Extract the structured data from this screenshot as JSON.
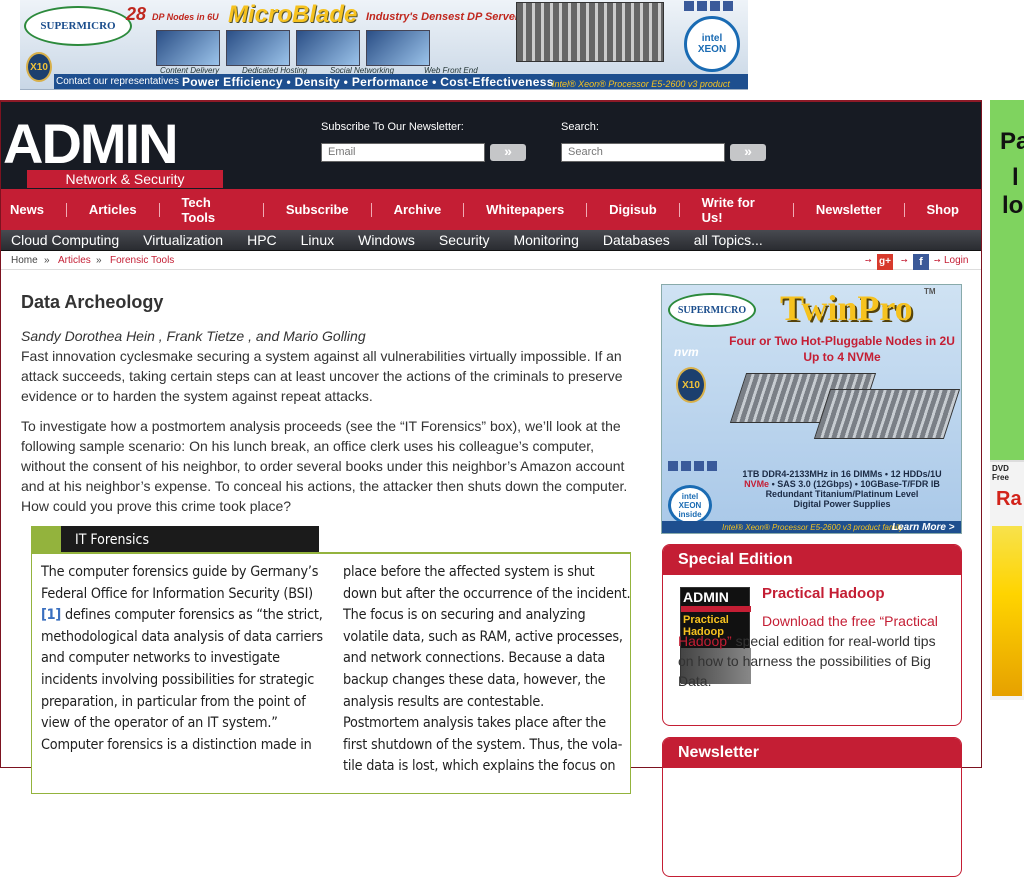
{
  "top_ad": {
    "brand": "SUPERMICRO",
    "count": "28",
    "nodes": "DP Nodes in 6U",
    "title": "MicroBlade",
    "tagline": "Industry's Densest DP Server",
    "captions": [
      "Content Delivery",
      "Dedicated Hosting",
      "Social Networking",
      "Web Front End"
    ],
    "contact": "Contact our representatives",
    "slogan": "Power Efficiency • Density • Performance • Cost-Effectiveness",
    "xeon": "Intel® Xeon® Processor E5-2600 v3 product family",
    "x10": "X10",
    "intel": "intel",
    "intel_sub": "XEON"
  },
  "side_ad": {
    "line1": "Pa",
    "line2": "l",
    "line3": "lo",
    "mag_top": "DVD Free",
    "mag_title": "Ra"
  },
  "header": {
    "logo": "ADMIN",
    "logo_sub": "Network & Security",
    "newsletter_label": "Subscribe To Our Newsletter:",
    "newsletter_placeholder": "Email",
    "search_label": "Search:",
    "search_placeholder": "Search",
    "go_glyph": "»"
  },
  "nav": {
    "items": [
      "News",
      "Articles",
      "Tech Tools",
      "Subscribe",
      "Archive",
      "Whitepapers",
      "Digisub",
      "Write for Us!",
      "Newsletter",
      "Shop"
    ]
  },
  "subnav": {
    "items": [
      "Cloud Computing",
      "Virtualization",
      "HPC",
      "Linux",
      "Windows",
      "Security",
      "Monitoring",
      "Databases",
      "all Topics..."
    ]
  },
  "breadcrumb": {
    "home": "Home",
    "sep": "»",
    "articles": "Articles",
    "current": "Forensic Tools",
    "login": "Login",
    "gplus": "g+",
    "fb": "f"
  },
  "article": {
    "title": "Data Archeology",
    "authors": "Sandy Dorothea Hein , Frank Tietze , and Mario Golling",
    "lead": "Fast innovation cyclesmake securing a system against all vulnerabilities virtually impossible. If an attack succeeds, taking certain steps can at least uncover the actions of the criminals to preserve evidence or to harden the system against repeat attacks.",
    "para1": "To investigate how a postmortem analysis proceeds (see the “IT Forensics” box), we’ll look at the following sample scenario: On his lunch break, an office clerk uses his colleague’s computer, without the consent of his neighbor, to order several books under this neighbor’s Amazon account and at his neighbor’s expense. To conceal his actions, the attacker then shuts down the computer. How could you prove this crime took place?",
    "box": {
      "title": "IT Forensics",
      "col1_a": "The computer forensics guide by Germany’s Federal Office for Information Security (BSI) ",
      "ref": "[1]",
      "col1_b": " defines computer forensics as “the strict, methodological data analysis of data carriers and computer networks to investigate incidents involving possibilities for strategic preparation, in particular from the point of view of the operator of an IT system.”",
      "col1_c": "Computer forensics is a distinction made in",
      "col2": "place before the affected system is shut down but after the occurrence of the incident. The focus is on securing and analyzing volatile data, such as RAM, active processes, and network connections. Because a data backup changes these data, however, the analysis results are contestable.",
      "col2_b": "Postmortem analysis takes place after the first shutdown of the system. Thus, the vola-tile data is lost, which explains the focus on"
    }
  },
  "twinpro_ad": {
    "brand": "SUPERMICRO",
    "title": "TwinPro",
    "tm": "TM",
    "headline": "Four or Two Hot-Pluggable Nodes in 2U Up to 4 NVMe",
    "nvme": "nvm",
    "x10": "X10",
    "spec1": "1TB DDR4-2133MHz in 16 DIMMs • 12 HDDs/1U",
    "spec2_hl": "NVMe",
    "spec2": " • SAS 3.0 (12Gbps) • 10GBase-T/FDR IB",
    "spec3": "Redundant Titanium/Platinum Level",
    "spec4": "Digital Power Supplies",
    "intel": "intel XEON inside",
    "foot": "Intel® Xeon® Processor E5-2600 v3 product family",
    "more": "Learn More >"
  },
  "special_edition": {
    "header": "Special Edition",
    "title": "Practical Hadoop",
    "link": "Download the free “Practical Hadoop”",
    "desc": " special edition for real-world tips on how to harness the possibilities of Big Data.",
    "cover_title": "ADMIN",
    "cover_sub": "Practical Hadoop"
  },
  "newsletter_box": {
    "header": "Newsletter"
  }
}
